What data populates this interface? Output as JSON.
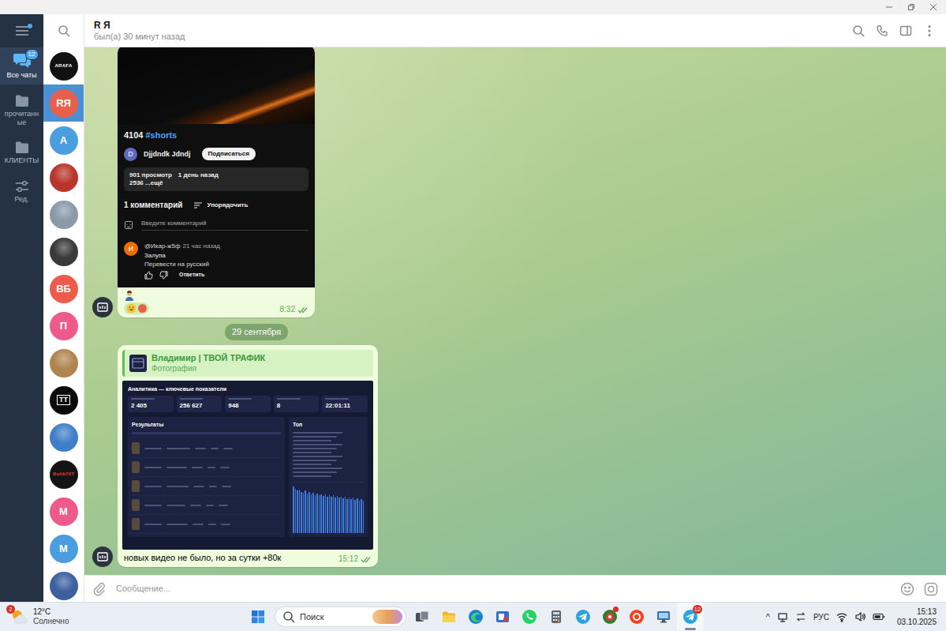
{
  "menu": {
    "notification_dot": true
  },
  "folders": [
    {
      "kind": "chats",
      "label": "Все чаты",
      "badge": "12",
      "selected": true
    },
    {
      "kind": "folder",
      "label": "прочитанные",
      "selected": false
    },
    {
      "kind": "folder",
      "label": "КЛИЕНТЫ",
      "selected": false
    },
    {
      "kind": "edit",
      "label": "Ред.",
      "selected": false
    }
  ],
  "chat_list": [
    {
      "kind": "logo",
      "label": "ARAFA",
      "color": "#111111",
      "text_color": "#ffffff",
      "selected": false
    },
    {
      "kind": "letters",
      "label": "RЯ",
      "color": "#e8604c",
      "selected": true
    },
    {
      "kind": "letters",
      "label": "А",
      "color": "#4a9ee0",
      "selected": false
    },
    {
      "kind": "photo",
      "color": "#b8352c",
      "selected": false
    },
    {
      "kind": "photo",
      "color": "#8a9aa8",
      "selected": false
    },
    {
      "kind": "photo",
      "color": "#3a3a3a",
      "selected": false
    },
    {
      "kind": "letters",
      "label": "ВБ",
      "color": "#ec5b4b",
      "selected": false
    },
    {
      "kind": "letters",
      "label": "П",
      "color": "#ee5a8a",
      "selected": false
    },
    {
      "kind": "photo",
      "color": "#b08450",
      "selected": false
    },
    {
      "kind": "logo",
      "label": "TT",
      "color": "#0a0a0a",
      "text_color": "#ffffff",
      "selected": false
    },
    {
      "kind": "photo",
      "color": "#3f7fc9",
      "selected": false
    },
    {
      "kind": "logo",
      "label": "Bulik707",
      "color": "#141414",
      "text_color": "#e23b3b",
      "selected": false
    },
    {
      "kind": "letters",
      "label": "М",
      "color": "#ee5a8a",
      "selected": false
    },
    {
      "kind": "letters",
      "label": "М",
      "color": "#4a9ee0",
      "selected": false
    },
    {
      "kind": "photo",
      "color": "#3c5fa0",
      "selected": false
    }
  ],
  "chat": {
    "title": "R Я",
    "status": "был(а) 30 минут назад"
  },
  "message_1": {
    "video": {
      "title": "4104",
      "hashtag": "#shorts",
      "channel_initial": "D",
      "channel": "Djjdndk Jdndj",
      "subscribe": "Подписаться",
      "views": "901 просмотр",
      "age": "1 день назад",
      "more": "2536 ...ещё",
      "comments": "1 комментарий",
      "sort": "Упорядочить",
      "comment_placeholder": "Введите комментарий",
      "comment": {
        "initial": "И",
        "author": "@Икар-ж5ф",
        "time": "21 час назад",
        "text": "Залупа",
        "translate": "Перевести на русский",
        "reply": "Ответить"
      }
    },
    "time": "8:32",
    "read": true
  },
  "date_separator": "29 сентября",
  "message_2": {
    "forward_from": "Владимир | ТВОЙ ТРАФИК",
    "forward_type": "Фотография",
    "dashboard": {
      "title": "Аналитика — ключевые показатели",
      "stats": [
        "2 405",
        "256 627",
        "948",
        "8",
        "22:01:11"
      ],
      "results_title": "Результаты",
      "top_title": "Топ",
      "bars": [
        96,
        92,
        88,
        90,
        86,
        84,
        88,
        82,
        85,
        80,
        83,
        78,
        82,
        79,
        81,
        77,
        80,
        76,
        79,
        75,
        78,
        74,
        77,
        73,
        76,
        72,
        75,
        71,
        74,
        70,
        73,
        69,
        72,
        68,
        71,
        67
      ]
    },
    "caption": "новых видео не было, но за сутки +80к",
    "time": "15:12",
    "read": true
  },
  "composer": {
    "placeholder": "Сообщение..."
  },
  "taskbar": {
    "weather": {
      "badge": "2",
      "temp": "12°C",
      "condition": "Солнечно"
    },
    "search": "Поиск",
    "apps": [
      {
        "kind": "taskview",
        "active": false,
        "notified": false
      },
      {
        "kind": "explorer",
        "active": false,
        "notified": false
      },
      {
        "kind": "edge",
        "active": false,
        "notified": false
      },
      {
        "kind": "media",
        "active": false,
        "notified": false
      },
      {
        "kind": "whatsapp",
        "active": false,
        "notified": false
      },
      {
        "kind": "calculator",
        "active": false,
        "notified": false
      },
      {
        "kind": "telegram",
        "active": false,
        "notified": false
      },
      {
        "kind": "app",
        "active": false,
        "notified": true
      },
      {
        "kind": "yandex",
        "active": false,
        "notified": false
      },
      {
        "kind": "remote",
        "active": false,
        "notified": false
      },
      {
        "kind": "telegram",
        "active": true,
        "notified": false,
        "badge": "12"
      }
    ],
    "tray": {
      "chevron": "^",
      "lang": "РУС",
      "time": "15:13",
      "date": "03.10.2025"
    }
  }
}
